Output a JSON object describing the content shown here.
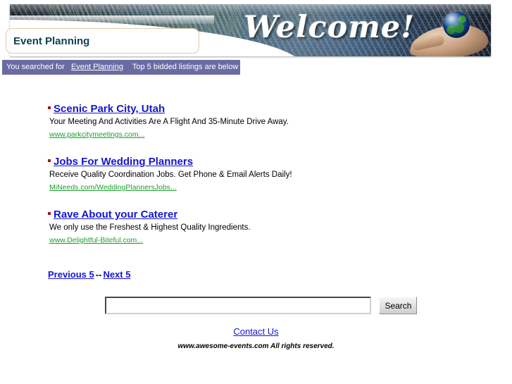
{
  "header": {
    "banner_text": "Welcome!",
    "banner_icon": "globe-in-hand-icon",
    "search_term": "Event Planning"
  },
  "search_info": {
    "prefix": "You searched for",
    "term": "Event Planning",
    "suffix": "Top 5 bidded listings are below",
    "bar_color": "#6b6ba3"
  },
  "listings": [
    {
      "title": "Scenic Park City, Utah",
      "description": "Your Meeting And Activities Are A Flight And 35-Minute Drive Away.",
      "url": "www.parkcitymeetings.com..."
    },
    {
      "title": "Jobs For Wedding Planners",
      "description": "Receive Quality Coordination Jobs. Get Phone & Email Alerts Daily!",
      "url": "MiNeeds.com/WeddingPlannersJobs..."
    },
    {
      "title": "Rave About your Caterer",
      "description": "We only use the Freshest & Highest Quality Ingredients.",
      "url": "www.Delightful-Biteful.com..."
    }
  ],
  "pagination": {
    "previous": "Previous 5",
    "separator": "--",
    "next": "Next 5"
  },
  "search_form": {
    "value": "",
    "placeholder": "",
    "button_label": "Search"
  },
  "footer": {
    "contact_label": "Contact Us",
    "copyright": "www.awesome-events.com All rights reserved."
  },
  "colors": {
    "link_blue": "#1515d0",
    "url_green": "#1f9e2e",
    "bullet_red": "#a01818",
    "term_teal": "#0d4355",
    "banner_purple": "#6b6ba3"
  }
}
